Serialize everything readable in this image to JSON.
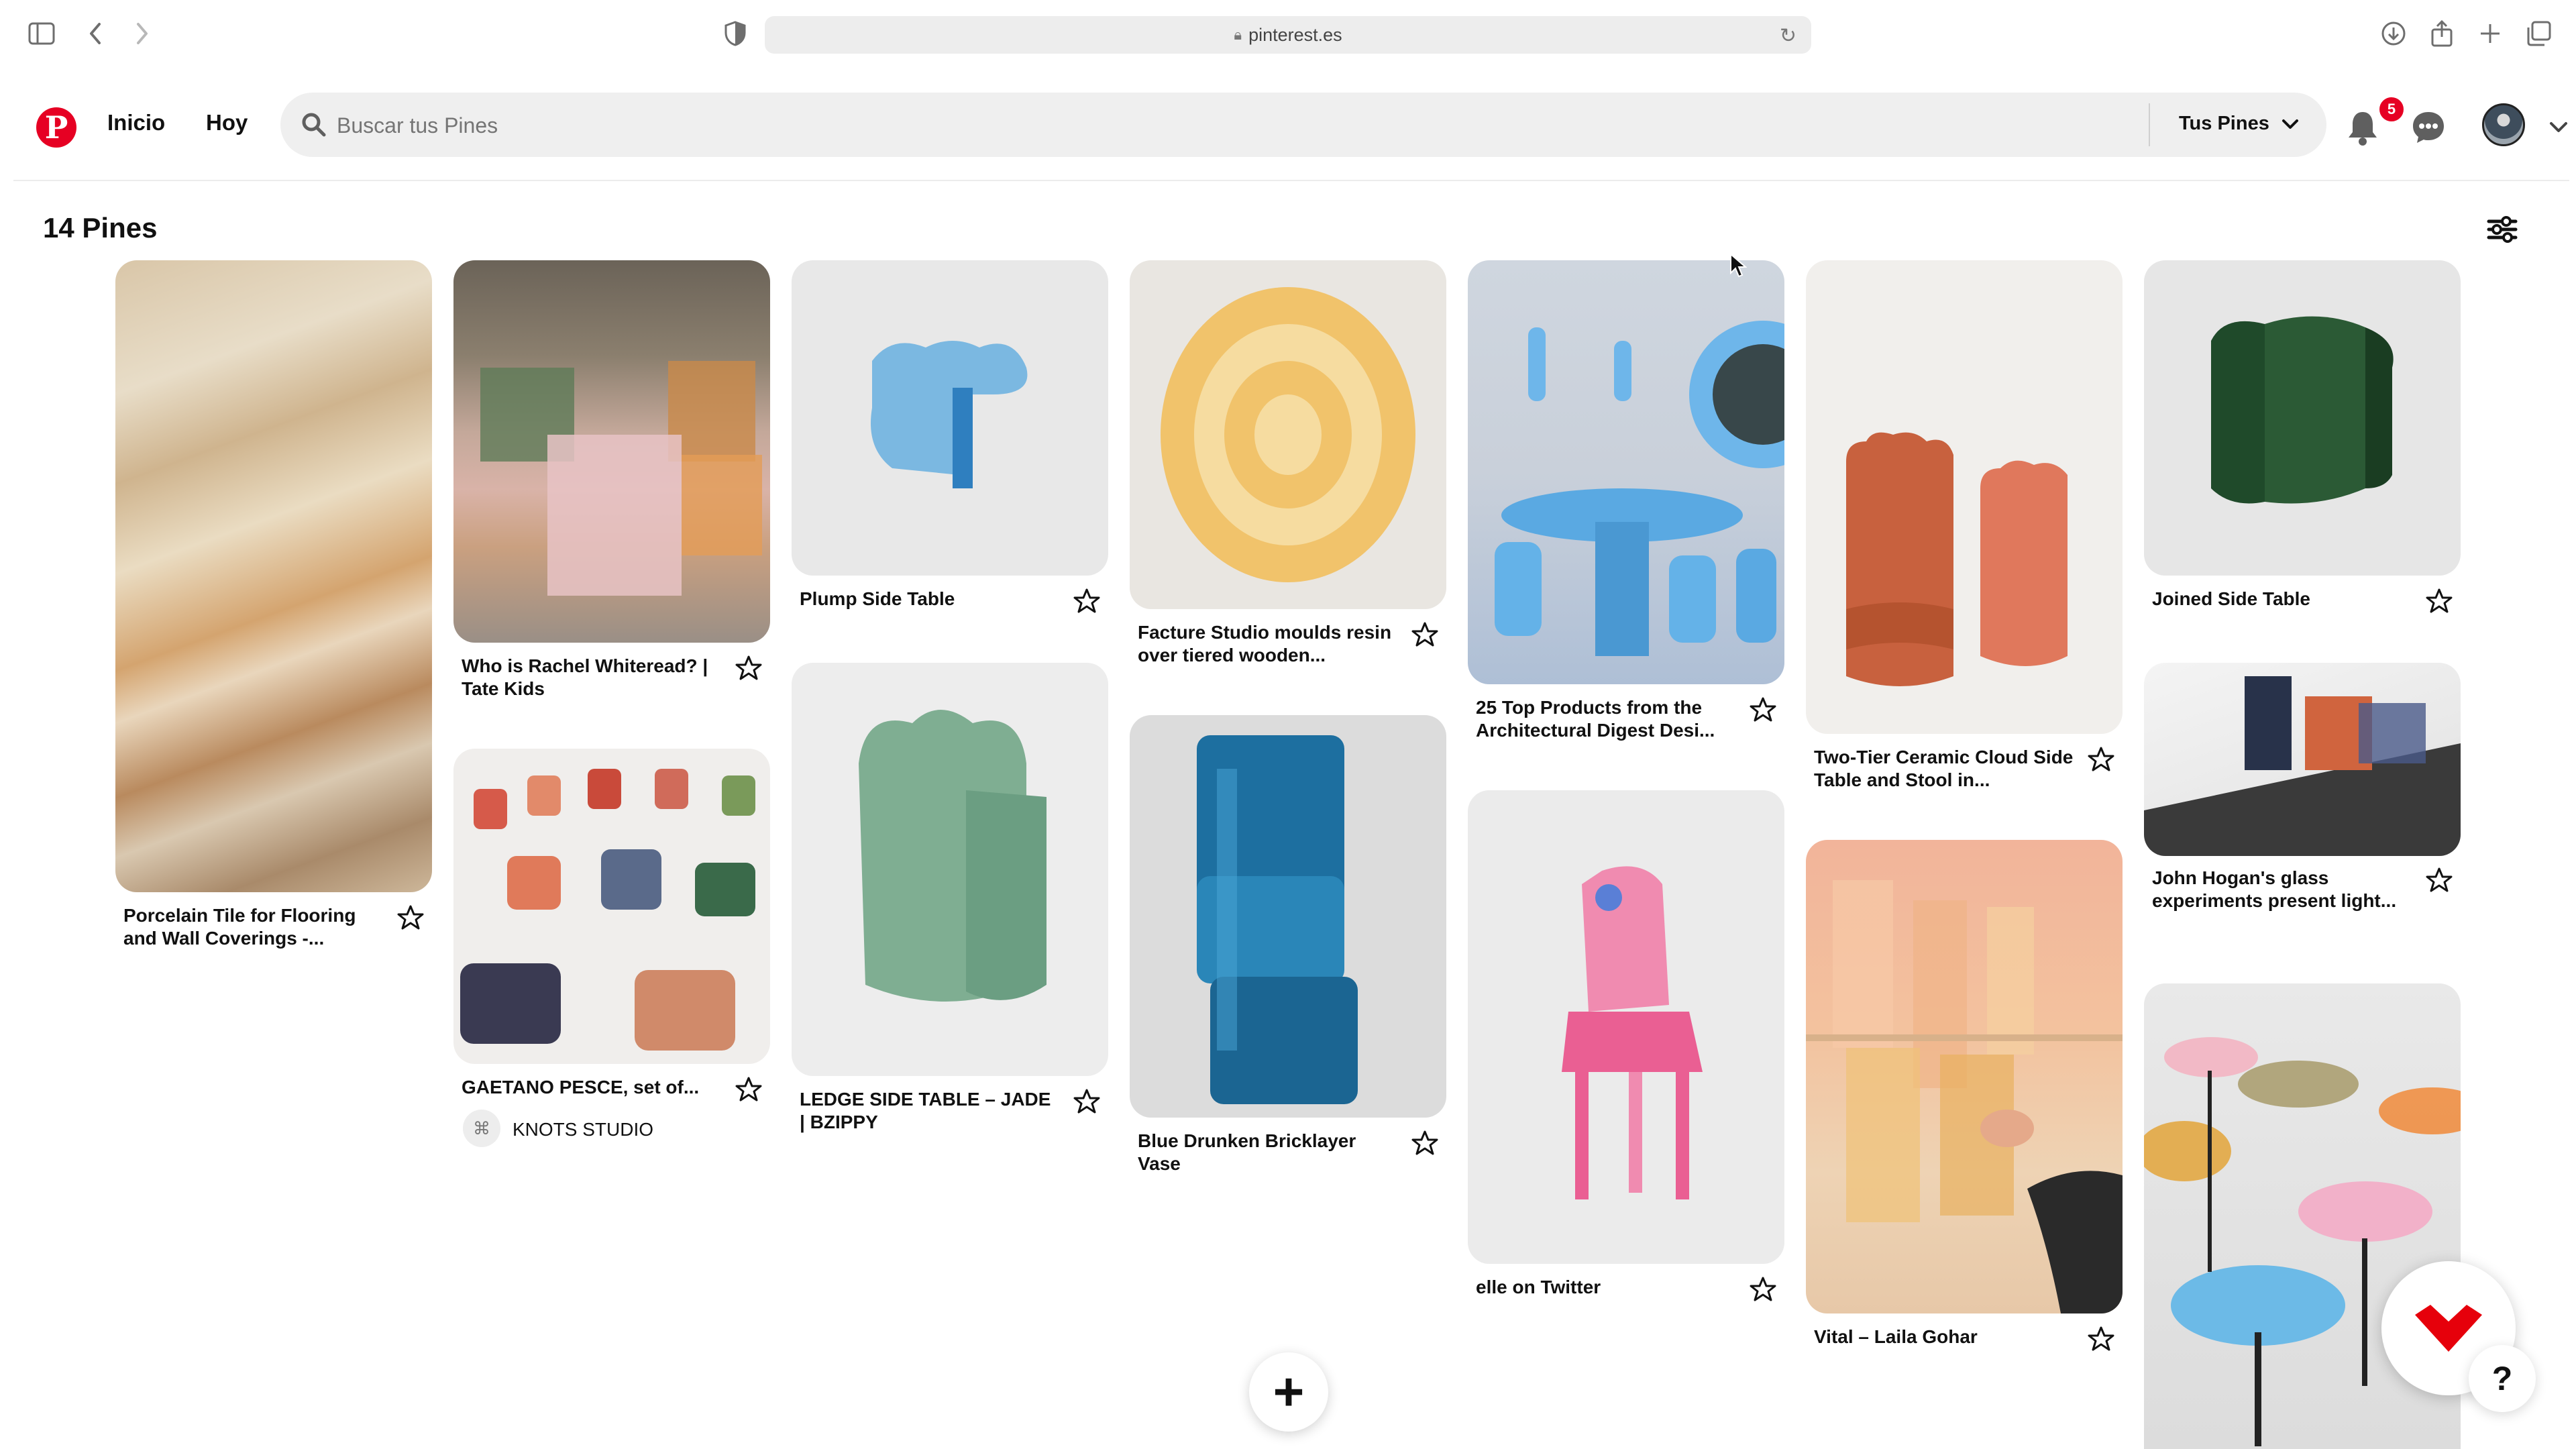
{
  "browser": {
    "url": "pinterest.es"
  },
  "header": {
    "logo": "P",
    "nav": [
      "Inicio",
      "Hoy"
    ],
    "search_placeholder": "Buscar tus Pines",
    "tus_pines_label": "Tus Pines",
    "notification_count": "5"
  },
  "board": {
    "pin_count_label": "14 Pines"
  },
  "pins": {
    "p1": {
      "title": "Porcelain Tile for Flooring and Wall Coverings -..."
    },
    "p2": {
      "title": "Who is Rachel Whiteread? | Tate Kids"
    },
    "p3": {
      "title": "GAETANO PESCE, set of...",
      "creator": "KNOTS STUDIO"
    },
    "p4": {
      "title": "Plump Side Table"
    },
    "p5": {
      "title": "LEDGE SIDE TABLE – JADE | BZIPPY"
    },
    "p6": {
      "title": "Facture Studio moulds resin over tiered wooden..."
    },
    "p7": {
      "title": "Blue Drunken Bricklayer Vase"
    },
    "p8": {
      "title": "25 Top Products from the Architectural Digest Desi..."
    },
    "p9": {
      "title": "elle on Twitter"
    },
    "p10": {
      "title": "Two-Tier Ceramic Cloud Side Table and Stool in..."
    },
    "p11": {
      "title": "Vital – Laila Gohar"
    },
    "p12": {
      "title": "Joined Side Table"
    },
    "p13": {
      "title": "John Hogan's glass experiments present light..."
    },
    "p14": {}
  },
  "fab": {
    "add": "+",
    "help": "?"
  },
  "colors": {
    "brand": "#e60023",
    "search_bg": "#efefef",
    "card_bg": "#ebebeb"
  },
  "icons": [
    "sidebar-icon",
    "back-icon",
    "forward-icon",
    "shield-icon",
    "lock-icon",
    "reload-icon",
    "download-icon",
    "share-icon",
    "new-tab-icon",
    "tabs-icon",
    "search-icon",
    "chevron-down-icon",
    "bell-icon",
    "chat-icon",
    "filter-icon",
    "star-icon",
    "heart-icon"
  ]
}
